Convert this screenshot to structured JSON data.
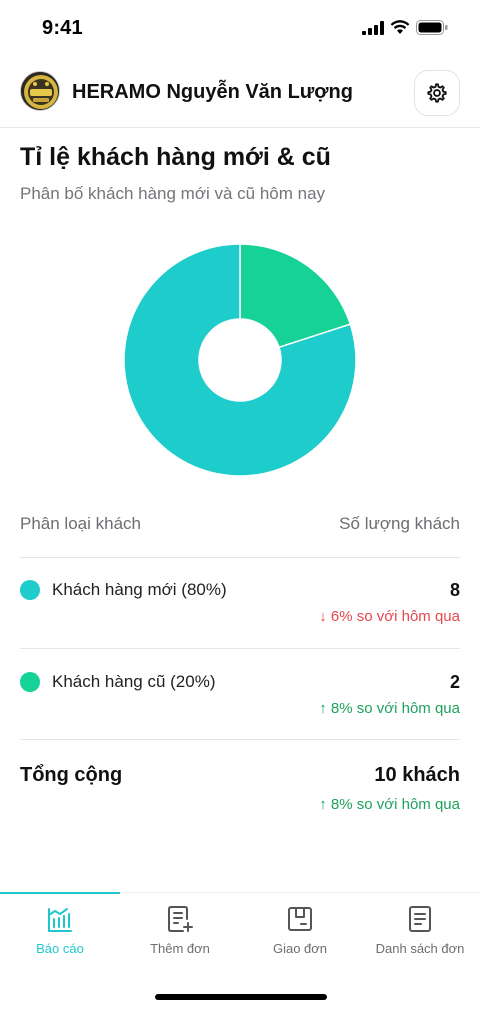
{
  "status_bar": {
    "time": "9:41"
  },
  "header": {
    "title": "HERAMO Nguyễn Văn Lượng",
    "avatar_icon": "store-logo-avatar",
    "settings_icon": "gear-icon"
  },
  "page": {
    "title": "Tỉ lệ khách hàng mới & cũ",
    "subtitle": "Phân bố khách hàng mới và cũ hôm nay"
  },
  "chart_data": {
    "type": "pie",
    "categories": [
      "Khách hàng mới (80%)",
      "Khách hàng cũ (20%)"
    ],
    "values": [
      80,
      20
    ],
    "colors": [
      "#1ecccb",
      "#17d296"
    ],
    "donut": true
  },
  "table": {
    "col_category": "Phân loại khách",
    "col_count": "Số lượng khách",
    "rows": [
      {
        "label": "Khách hàng mới (80%)",
        "count": "8",
        "change": "↓ 6% so với hôm qua",
        "trend": "down",
        "color": "#1ecccb"
      },
      {
        "label": "Khách hàng cũ (20%)",
        "count": "2",
        "change": "↑ 8% so với hôm qua",
        "trend": "up",
        "color": "#17d296"
      }
    ],
    "total_label": "Tổng cộng",
    "total_count": "10 khách",
    "total_change": "↑ 8% so với hôm qua"
  },
  "nav": {
    "items": [
      {
        "label": "Báo cáo",
        "icon": "report-chart-icon",
        "active": true
      },
      {
        "label": "Thêm đơn",
        "icon": "add-order-icon",
        "active": false
      },
      {
        "label": "Giao đơn",
        "icon": "delivery-box-icon",
        "active": false
      },
      {
        "label": "Danh sách đơn",
        "icon": "order-list-icon",
        "active": false
      }
    ]
  },
  "colors": {
    "accent": "#1fc7cc",
    "down": "#e5484d",
    "up": "#1fa35c"
  }
}
